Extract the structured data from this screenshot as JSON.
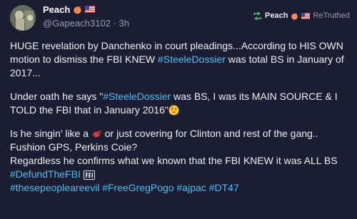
{
  "post": {
    "author_name": "Peach",
    "author_handle": "@Gapeach3102",
    "time_separator": "·",
    "time": "3h",
    "retruth_name": "Peach",
    "retruth_label": "ReTruthed",
    "paragraph1": {
      "text_a": "HUGE revelation by Danchenko in court pleadings...According to HIS OWN motion to dismiss the FBI KNEW ",
      "tag": "#SteeleDossier",
      "text_b": " was total BS in January of 2017..."
    },
    "paragraph2": {
      "text_a": "Under oath he says \"",
      "tag": "#SteeleDossier",
      "text_b": " was BS, I was its MAIN SOURCE & I TOLD the FBI that in January  2016\""
    },
    "paragraph3": {
      "text_a": "Is he singin’ like a ",
      "text_b": " or just covering for Clinton and rest of the gang.. Fushion GPS, Perkins Coie?",
      "text_c": "Regardless he confirms what we known that the FBI KNEW it was ALL BS ",
      "tag": "#DefundTheFBI",
      "hashtags": [
        "#thesepeopleareevil",
        "#FreeGregPogo",
        "#ajpac",
        "#DT47"
      ]
    },
    "icons": {
      "avatar": "avatar-photo",
      "peach": "peach-emoji-icon",
      "flag": "us-flag-icon",
      "retruth": "retruth-arrows-icon",
      "thinking": "raised-eyebrow-emoji-icon",
      "bird": "red-bird-emoji-icon",
      "fbi": "fbi-badge-icon"
    },
    "colors": {
      "background": "#1c1c32",
      "hashtag": "#4fc0f0",
      "retruth_icon": "#3fc97a"
    }
  }
}
